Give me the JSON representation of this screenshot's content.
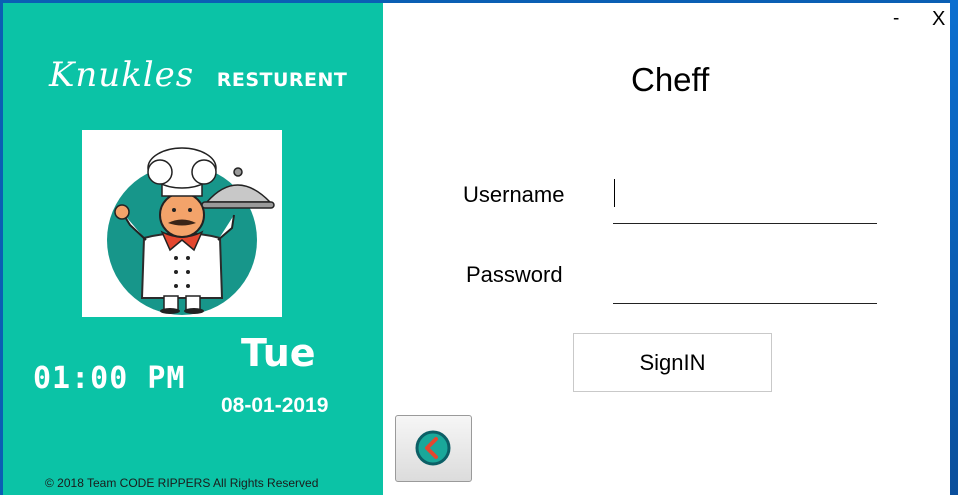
{
  "window": {
    "minimize_label": "-",
    "close_label": "X"
  },
  "brand": {
    "script_name": "Knukles",
    "word": "RESTURENT"
  },
  "clock": {
    "time": "01:00 PM",
    "day": "Tue",
    "date": "08-01-2019"
  },
  "footer": {
    "copyright": "© 2018 Team CODE RIPPERS All Rights Reserved"
  },
  "login": {
    "role_title": "Cheff",
    "username_label": "Username",
    "username_value": "",
    "password_label": "Password",
    "password_value": "",
    "signin_label": "SignIN"
  },
  "colors": {
    "panel": "#0bc3a6",
    "accent": "#e4472f"
  },
  "icons": {
    "back": "chevron-left-icon",
    "chef": "chef-illustration"
  }
}
